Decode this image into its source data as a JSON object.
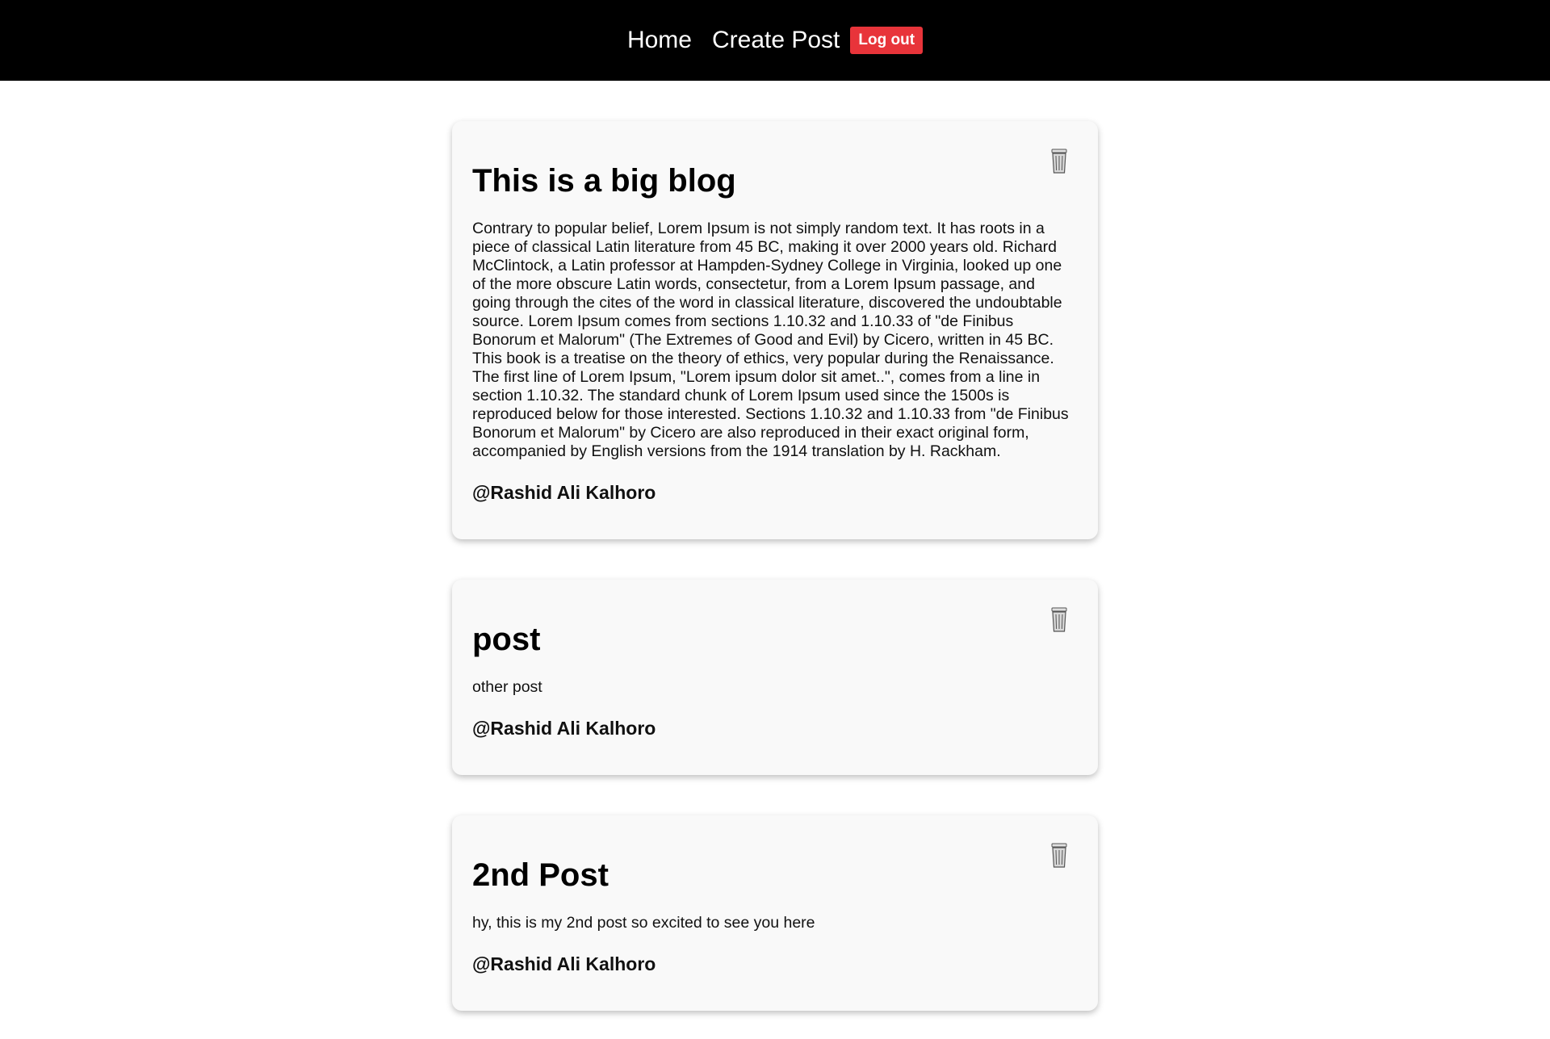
{
  "nav": {
    "home_label": "Home",
    "create_post_label": "Create Post",
    "logout_label": "Log out"
  },
  "colors": {
    "navbar_bg": "#000000",
    "logout_bg": "#e8343a",
    "card_bg": "#f9f9f9"
  },
  "posts": [
    {
      "title": "This is a big blog",
      "body": "Contrary to popular belief, Lorem Ipsum is not simply random text. It has roots in a piece of classical Latin literature from 45 BC, making it over 2000 years old. Richard McClintock, a Latin professor at Hampden-Sydney College in Virginia, looked up one of the more obscure Latin words, consectetur, from a Lorem Ipsum passage, and going through the cites of the word in classical literature, discovered the undoubtable source. Lorem Ipsum comes from sections 1.10.32 and 1.10.33 of \"de Finibus Bonorum et Malorum\" (The Extremes of Good and Evil) by Cicero, written in 45 BC. This book is a treatise on the theory of ethics, very popular during the Renaissance. The first line of Lorem Ipsum, \"Lorem ipsum dolor sit amet..\", comes from a line in section 1.10.32. The standard chunk of Lorem Ipsum used since the 1500s is reproduced below for those interested. Sections 1.10.32 and 1.10.33 from \"de Finibus Bonorum et Malorum\" by Cicero are also reproduced in their exact original form, accompanied by English versions from the 1914 translation by H. Rackham.",
      "author": "@Rashid Ali Kalhoro",
      "delete_icon": "trash-icon"
    },
    {
      "title": "post",
      "body": "other post",
      "author": "@Rashid Ali Kalhoro",
      "delete_icon": "trash-icon"
    },
    {
      "title": "2nd Post",
      "body": "hy, this is my 2nd post so excited to see you here",
      "author": "@Rashid Ali Kalhoro",
      "delete_icon": "trash-icon"
    }
  ]
}
